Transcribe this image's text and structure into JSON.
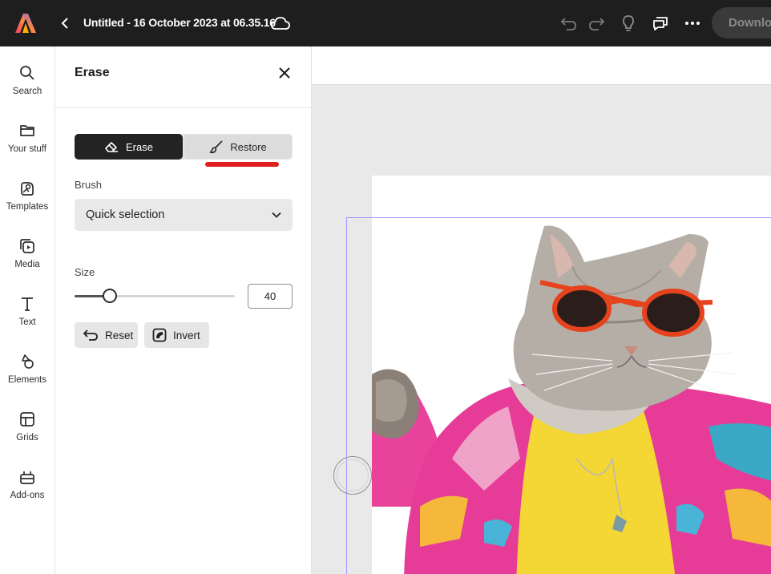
{
  "topbar": {
    "title": "Untitled - 16 October 2023 at 06.35.16",
    "download_label": "Download"
  },
  "rail": {
    "items": [
      {
        "label": "Search",
        "icon": "search-icon"
      },
      {
        "label": "Your stuff",
        "icon": "folder-icon"
      },
      {
        "label": "Templates",
        "icon": "templates-icon"
      },
      {
        "label": "Media",
        "icon": "media-icon"
      },
      {
        "label": "Text",
        "icon": "text-icon"
      },
      {
        "label": "Elements",
        "icon": "elements-icon"
      },
      {
        "label": "Grids",
        "icon": "grids-icon"
      },
      {
        "label": "Add-ons",
        "icon": "add-ons-icon"
      }
    ]
  },
  "panel": {
    "title": "Erase",
    "erase_label": "Erase",
    "restore_label": "Restore",
    "brush_label": "Brush",
    "brush_value": "Quick selection",
    "size_label": "Size",
    "size_value": "40",
    "size_fraction": 0.22,
    "reset_label": "Reset",
    "invert_label": "Invert"
  },
  "colors": {
    "topbar": "#1e1e1e",
    "accent_red": "#e01e1e",
    "selection": "#9c97ff"
  }
}
